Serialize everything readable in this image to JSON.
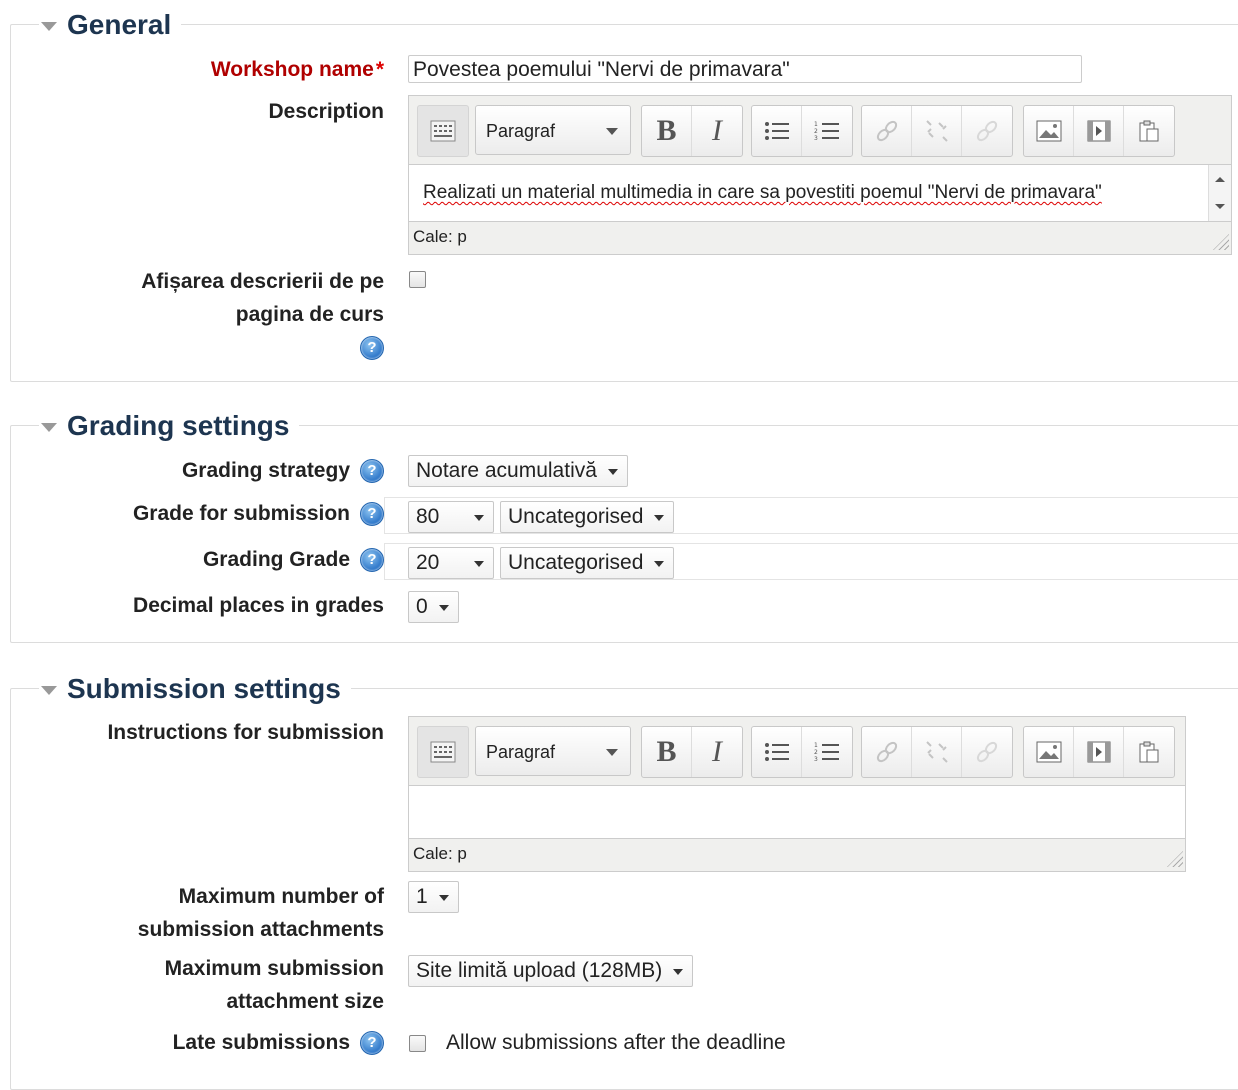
{
  "general": {
    "legend": "General",
    "workshop_name_label": "Workshop name",
    "workshop_name_value": "Povestea poemului \"Nervi de primavara\"",
    "description_label": "Description",
    "description_text": "Realizati un material multimedia in care sa povestiti poemul \"Nervi de primavara\"",
    "editor_format": "Paragraf",
    "editor_path": "Cale: p",
    "show_desc_label_line1": "Afișarea descrierii de pe",
    "show_desc_label_line2": "pagina de curs",
    "show_desc_checked": false
  },
  "grading": {
    "legend": "Grading settings",
    "strategy_label": "Grading strategy",
    "strategy_value": "Notare acumulativă",
    "submission_grade_label": "Grade for submission",
    "submission_grade_value": "80",
    "submission_grade_category": "Uncategorised",
    "grading_grade_label": "Grading Grade",
    "grading_grade_value": "20",
    "grading_grade_category": "Uncategorised",
    "decimals_label": "Decimal places in grades",
    "decimals_value": "0"
  },
  "submission": {
    "legend": "Submission settings",
    "instructions_label": "Instructions for submission",
    "editor_format": "Paragraf",
    "editor_path": "Cale: p",
    "max_attachments_label_line1": "Maximum number of",
    "max_attachments_label_line2": "submission attachments",
    "max_attachments_value": "1",
    "max_size_label_line1": "Maximum submission",
    "max_size_label_line2": "attachment size",
    "max_size_value": "Site limită upload (128MB)",
    "late_label": "Late submissions",
    "late_checkbox_text": "Allow submissions after the deadline",
    "late_checked": false
  },
  "help_icon_glyph": "?",
  "colors": {
    "legend": "#1d3550",
    "required": "#b00000",
    "help": "#2a74c8"
  }
}
